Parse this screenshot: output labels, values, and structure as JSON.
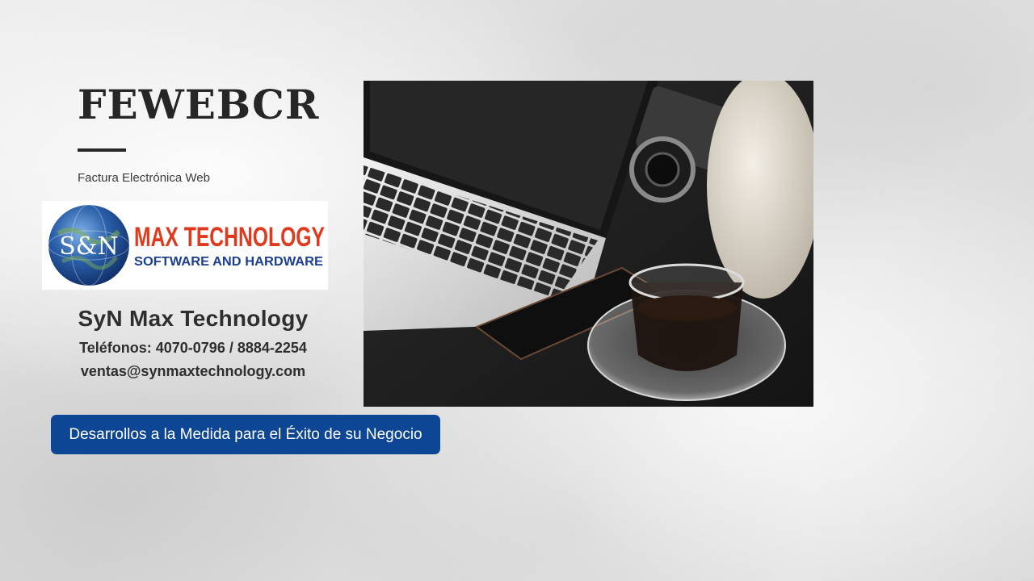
{
  "header": {
    "title": "FEWEBCR",
    "subtitle": "Factura Electrónica Web"
  },
  "logo": {
    "globe_text": "S&N",
    "brand_line1": "MAX TECHNOLOGY",
    "brand_line2": "SOFTWARE AND HARDWARE"
  },
  "company": {
    "name": "SyN Max Technology",
    "phones": "Teléfonos: 4070-0796 / 8884-2254",
    "email": "ventas@synmaxtechnology.com"
  },
  "cta": {
    "label": "Desarrollos a la Medida para el Éxito de su Negocio"
  },
  "colors": {
    "button_bg": "#0d4694",
    "brand_red": "#e03a1e",
    "brand_blue": "#1c3f8f",
    "text_dark": "#262626"
  },
  "image": {
    "subject": "laptop-camera-coffee-photo"
  }
}
